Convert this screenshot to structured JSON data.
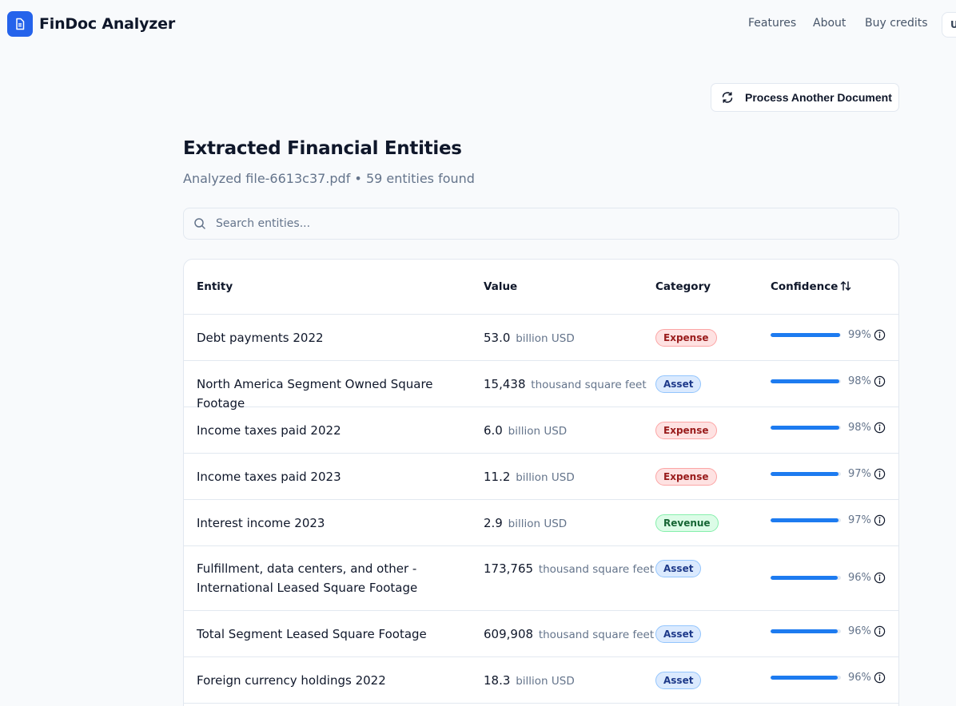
{
  "nav": {
    "brand": "FinDoc Analyzer",
    "links": [
      "Features",
      "About",
      "Buy credits"
    ],
    "user_initial": "U"
  },
  "actions": {
    "process_label": "Process Another Document"
  },
  "header": {
    "title": "Extracted Financial Entities",
    "subtitle": "Analyzed file-6613c37.pdf • 59 entities found"
  },
  "search": {
    "placeholder": "Search entities..."
  },
  "table": {
    "columns": [
      "Entity",
      "Value",
      "Category",
      "Confidence"
    ],
    "rows": [
      {
        "entity": "Debt payments 2022",
        "value": "53.0",
        "unit": "billion USD",
        "category": "Expense",
        "cat_class": "expense",
        "confidence": "99%",
        "conf_value": 99
      },
      {
        "entity": "North America Segment Owned Square Footage",
        "value": "15,438",
        "unit": "thousand square feet",
        "category": "Asset",
        "cat_class": "asset",
        "confidence": "98%",
        "conf_value": 98
      },
      {
        "entity": "Income taxes paid 2022",
        "value": "6.0",
        "unit": "billion USD",
        "category": "Expense",
        "cat_class": "expense",
        "confidence": "98%",
        "conf_value": 98
      },
      {
        "entity": "Income taxes paid 2023",
        "value": "11.2",
        "unit": "billion USD",
        "category": "Expense",
        "cat_class": "expense",
        "confidence": "97%",
        "conf_value": 97
      },
      {
        "entity": "Interest income 2023",
        "value": "2.9",
        "unit": "billion USD",
        "category": "Revenue",
        "cat_class": "revenue",
        "confidence": "97%",
        "conf_value": 97
      },
      {
        "entity": "Fulfillment, data centers, and other - International Leased Square Footage",
        "value": "173,765",
        "unit": "thousand square feet",
        "category": "Asset",
        "cat_class": "asset",
        "confidence": "96%",
        "conf_value": 96
      },
      {
        "entity": "Total Segment Leased Square Footage",
        "value": "609,908",
        "unit": "thousand square feet",
        "category": "Asset",
        "cat_class": "asset",
        "confidence": "96%",
        "conf_value": 96
      },
      {
        "entity": "Foreign currency holdings 2022",
        "value": "18.3",
        "unit": "billion USD",
        "category": "Asset",
        "cat_class": "asset",
        "confidence": "96%",
        "conf_value": 96
      }
    ]
  },
  "colors": {
    "accent": "#2563eb",
    "bar": "#1d7bf0"
  }
}
